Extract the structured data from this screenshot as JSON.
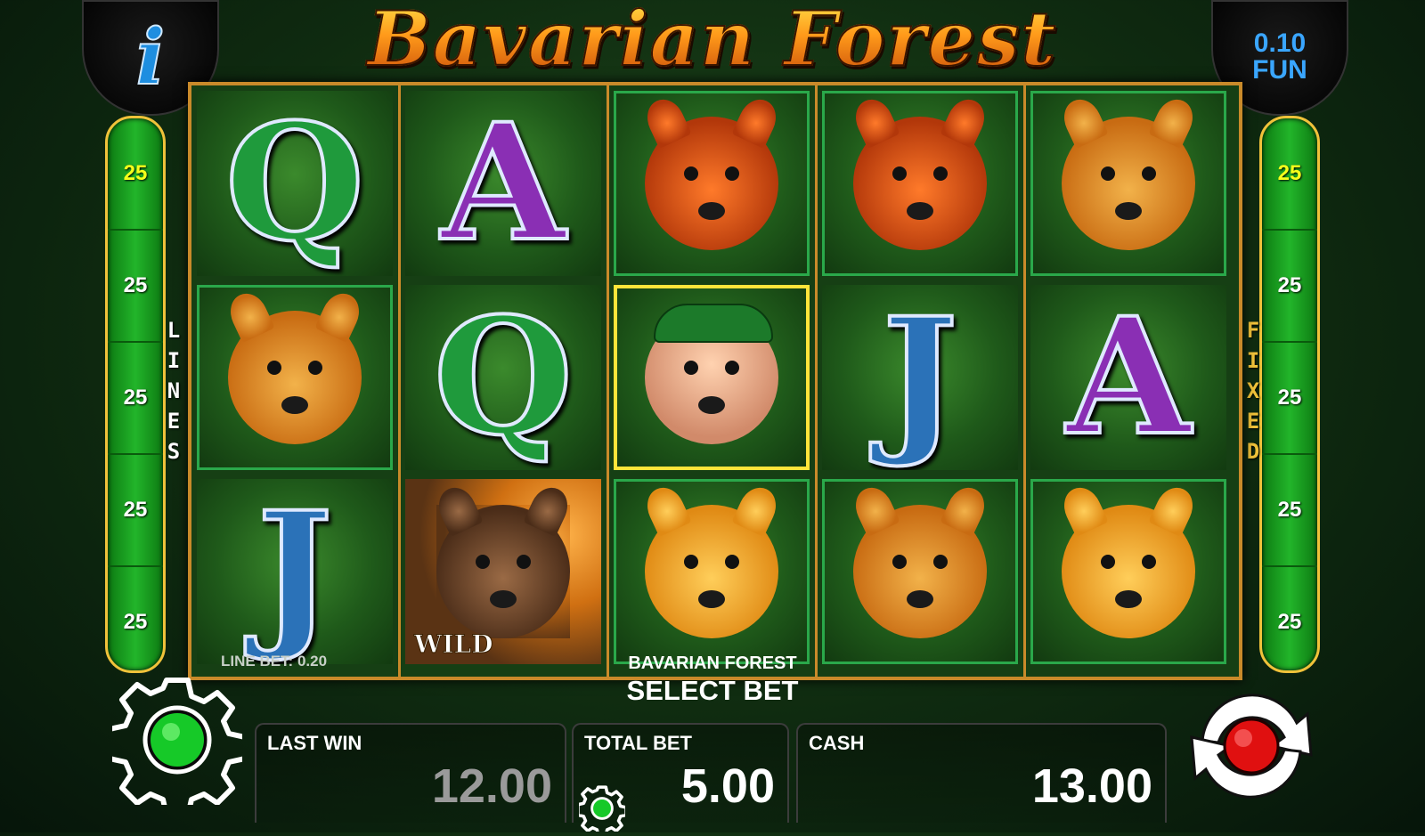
{
  "header": {
    "game_title": "Bavarian Forest",
    "info_icon_glyph": "i",
    "coin_value": "0.10",
    "coin_mode": "FUN"
  },
  "side_left": {
    "label": [
      "L",
      "I",
      "N",
      "E",
      "S"
    ],
    "values": [
      "25",
      "25",
      "25",
      "25",
      "25"
    ]
  },
  "side_right": {
    "label": [
      "F",
      "I",
      "X",
      "E",
      "D"
    ],
    "values": [
      "25",
      "25",
      "25",
      "25",
      "25"
    ]
  },
  "reels": [
    [
      {
        "symbol": "Q",
        "kind": "letter",
        "color": "green"
      },
      {
        "symbol": "deer",
        "kind": "animal"
      },
      {
        "symbol": "J",
        "kind": "letter",
        "color": "blue"
      }
    ],
    [
      {
        "symbol": "A",
        "kind": "letter",
        "color": "purple"
      },
      {
        "symbol": "Q",
        "kind": "letter",
        "color": "green"
      },
      {
        "symbol": "bear",
        "kind": "wild",
        "label": "WILD"
      }
    ],
    [
      {
        "symbol": "squirrel",
        "kind": "animal"
      },
      {
        "symbol": "hunter",
        "kind": "scatter"
      },
      {
        "symbol": "fox",
        "kind": "animal"
      }
    ],
    [
      {
        "symbol": "squirrel",
        "kind": "animal"
      },
      {
        "symbol": "J",
        "kind": "letter",
        "color": "blue"
      },
      {
        "symbol": "deer",
        "kind": "animal"
      }
    ],
    [
      {
        "symbol": "deer",
        "kind": "animal"
      },
      {
        "symbol": "A",
        "kind": "letter",
        "color": "purple"
      },
      {
        "symbol": "fox",
        "kind": "animal"
      }
    ]
  ],
  "bottom": {
    "line_bet_text": "LINE BET: 0.20",
    "game_name": "BAVARIAN FOREST",
    "select_bet": "SELECT BET",
    "last_win_label": "LAST WIN",
    "last_win_value": "12.00",
    "total_bet_label": "TOTAL BET",
    "total_bet_value": "5.00",
    "cash_label": "CASH",
    "cash_value": "13.00"
  },
  "icons": {
    "settings": "gear-icon",
    "spin": "spin-icon",
    "info": "info-icon",
    "bet_settings": "small-gear-icon"
  },
  "colors": {
    "title_gradient_top": "#ffe34a",
    "title_gradient_bottom": "#c64a08",
    "frame": "#c98a2a",
    "side_panel": "#22b52a",
    "active_line": "#f5ff1a",
    "coin_text": "#3aa6ff",
    "settings_button": "#16c928",
    "spin_button": "#e01010"
  }
}
